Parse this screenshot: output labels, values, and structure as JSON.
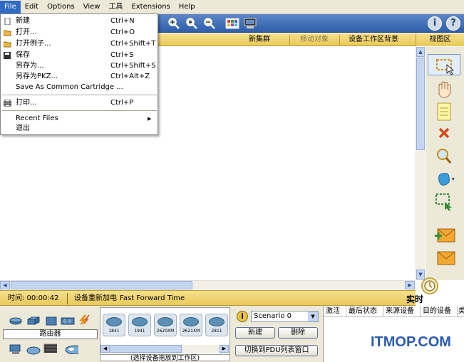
{
  "menubar": {
    "items": [
      "File",
      "Edit",
      "Options",
      "View",
      "工具",
      "Extensions",
      "Help"
    ]
  },
  "subheader": {
    "new_cluster": "新集群",
    "move_object": "移动对象",
    "device_bg": "设备工作区背景",
    "view_tab": "视图区"
  },
  "file_menu": {
    "items": [
      {
        "label": "新建",
        "shortcut": "Ctrl+N",
        "icon": "new-file-icon"
      },
      {
        "label": "打开...",
        "shortcut": "Ctrl+O",
        "icon": "open-folder-icon"
      },
      {
        "label": "打开例子...",
        "shortcut": "Ctrl+Shift+T",
        "icon": "open-folder-icon"
      },
      {
        "label": "保存",
        "shortcut": "Ctrl+S",
        "icon": "save-icon"
      },
      {
        "label": "另存为...",
        "shortcut": "Ctrl+Shift+S",
        "icon": ""
      },
      {
        "label": "另存为PKZ...",
        "shortcut": "Ctrl+Alt+Z",
        "icon": ""
      },
      {
        "label": "Save As Common Cartridge ...",
        "shortcut": "",
        "icon": ""
      },
      {
        "label": "打印...",
        "shortcut": "Ctrl+P",
        "icon": "printer-icon"
      },
      {
        "label": "Recent Files",
        "shortcut": "",
        "icon": "",
        "submenu": "▶"
      },
      {
        "label": "退出",
        "shortcut": "",
        "icon": ""
      }
    ]
  },
  "status": {
    "time": "时间: 00:00:42",
    "power_cycle": "设备重新加电",
    "fast_forward": "Fast Forward Time",
    "mode": "实时"
  },
  "devices": {
    "category_label": "路由器",
    "models": [
      "1841",
      "1941",
      "2620XM",
      "2621XM",
      "2811"
    ],
    "hint": "(选择设备拖放到工作区)"
  },
  "scenario": {
    "info": "i",
    "selected": "Scenario 0",
    "new_button": "新建",
    "delete_button": "删除",
    "pdu_toggle": "切换到PDU列表窗口"
  },
  "pdu_table": {
    "columns": [
      "激活",
      "最后状态",
      "来源设备",
      "目的设备",
      "类"
    ]
  },
  "watermark": "ITMOP.COM",
  "colors": {
    "accent": "#316ac5",
    "toolbar": "#2f5ea8",
    "statusbar": "#e9c95b"
  }
}
